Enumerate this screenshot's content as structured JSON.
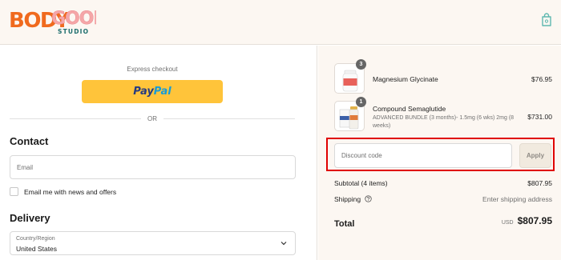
{
  "header": {
    "logo_text_line1": "BODYGOOD",
    "logo_text_line2": "STUDIO",
    "cart_icon": "shopping-bag-icon"
  },
  "express": {
    "label": "Express checkout",
    "paypal_label_1": "Pay",
    "paypal_label_2": "Pal",
    "or_label": "OR"
  },
  "contact": {
    "heading": "Contact",
    "email_placeholder": "Email",
    "newsletter_label": "Email me with news and offers"
  },
  "delivery": {
    "heading": "Delivery",
    "country_label": "Country/Region",
    "country_value": "United States"
  },
  "order": {
    "items": [
      {
        "name": "Magnesium Glycinate",
        "quantity": "3",
        "price": "$76.95",
        "subtitle": ""
      },
      {
        "name": "Compound Semaglutide",
        "quantity": "1",
        "price": "$731.00",
        "subtitle": "ADVANCED BUNDLE (3 months)- 1.5mg (6 wks) 2mg (8 weeks)"
      }
    ],
    "discount_placeholder": "Discount code",
    "apply_label": "Apply",
    "subtotal_label": "Subtotal (4 items)",
    "subtotal_value": "$807.95",
    "shipping_label": "Shipping",
    "shipping_value": "Enter shipping address",
    "total_label": "Total",
    "currency": "USD",
    "total_value": "$807.95"
  },
  "colors": {
    "paypal_yellow": "#ffc43a",
    "highlight_red": "#e00000",
    "logo_orange": "#f06a1e",
    "logo_pink": "#f5a6a8",
    "logo_teal": "#1e6e6e",
    "cart_icon_teal": "#5fb8b0"
  }
}
